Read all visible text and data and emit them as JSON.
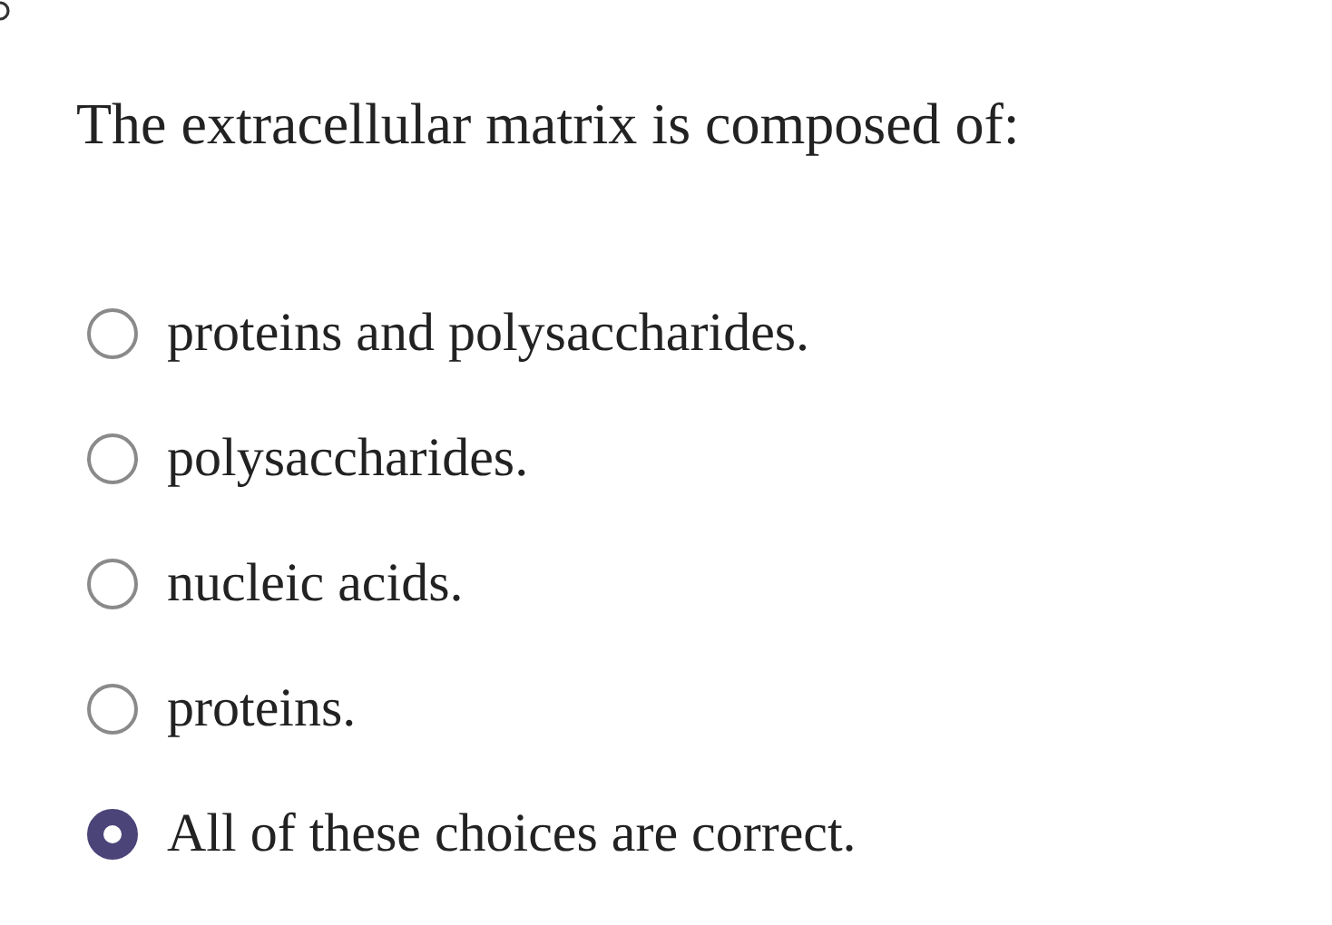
{
  "question": "The extracellular matrix is composed of:",
  "options": [
    {
      "label": "proteins and polysaccharides.",
      "selected": false
    },
    {
      "label": "polysaccharides.",
      "selected": false
    },
    {
      "label": "nucleic acids.",
      "selected": false
    },
    {
      "label": "proteins.",
      "selected": false
    },
    {
      "label": "All of these choices are correct.",
      "selected": true
    }
  ]
}
